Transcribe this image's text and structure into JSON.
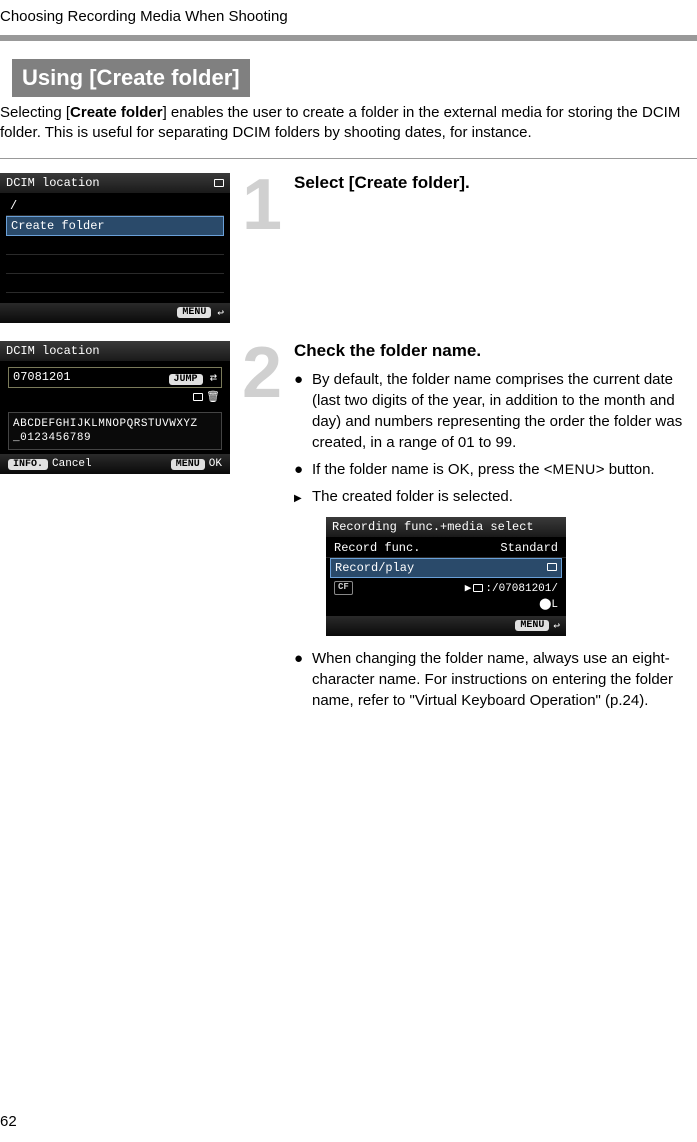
{
  "page": {
    "header": "Choosing Recording Media When Shooting",
    "section_heading": "Using [Create folder]",
    "intro_prefix": "Selecting [",
    "intro_bold": "Create folder",
    "intro_suffix": "] enables the user to create a folder in the external media for storing the DCIM folder. This is useful for separating DCIM folders by shooting dates, for instance.",
    "page_number": "62"
  },
  "step1": {
    "number": "1",
    "title": "Select [Create folder].",
    "shot": {
      "title": "DCIM location",
      "row_root": "/",
      "row_highlight": "Create folder",
      "footer_menu": "MENU",
      "footer_return": "↩"
    }
  },
  "step2": {
    "number": "2",
    "title": "Check the folder name.",
    "b1": "By default, the folder name comprises the current date (last two digits of the year, in addition to the month and day) and numbers representing the order the folder was created, in a range of 01 to 99.",
    "b2_prefix": "If the folder name is OK, press the <",
    "b2_menu": "MENU",
    "b2_suffix": "> button.",
    "b3": "The created folder is selected.",
    "b4": "When changing the folder name, always use an eight-character name. For instructions on entering the folder name, refer to \"Virtual Keyboard Operation\" (p.24).",
    "shot": {
      "title": "DCIM location",
      "field_value": "07081201",
      "jump_label": "JUMP",
      "kb_line1": "ABCDEFGHIJKLMNOPQRSTUVWXYZ",
      "kb_line2": "_0123456789",
      "info": "INFO.",
      "cancel": "Cancel",
      "menu": "MENU",
      "ok": "OK"
    },
    "shot3": {
      "title": "Recording func.+media select",
      "row1_l": "Record func.",
      "row1_r": "Standard",
      "row2_l": "Record/play",
      "path_line": ":/07081201/",
      "quality": "⬤L",
      "footer_menu": "MENU",
      "footer_return": "↩"
    }
  }
}
